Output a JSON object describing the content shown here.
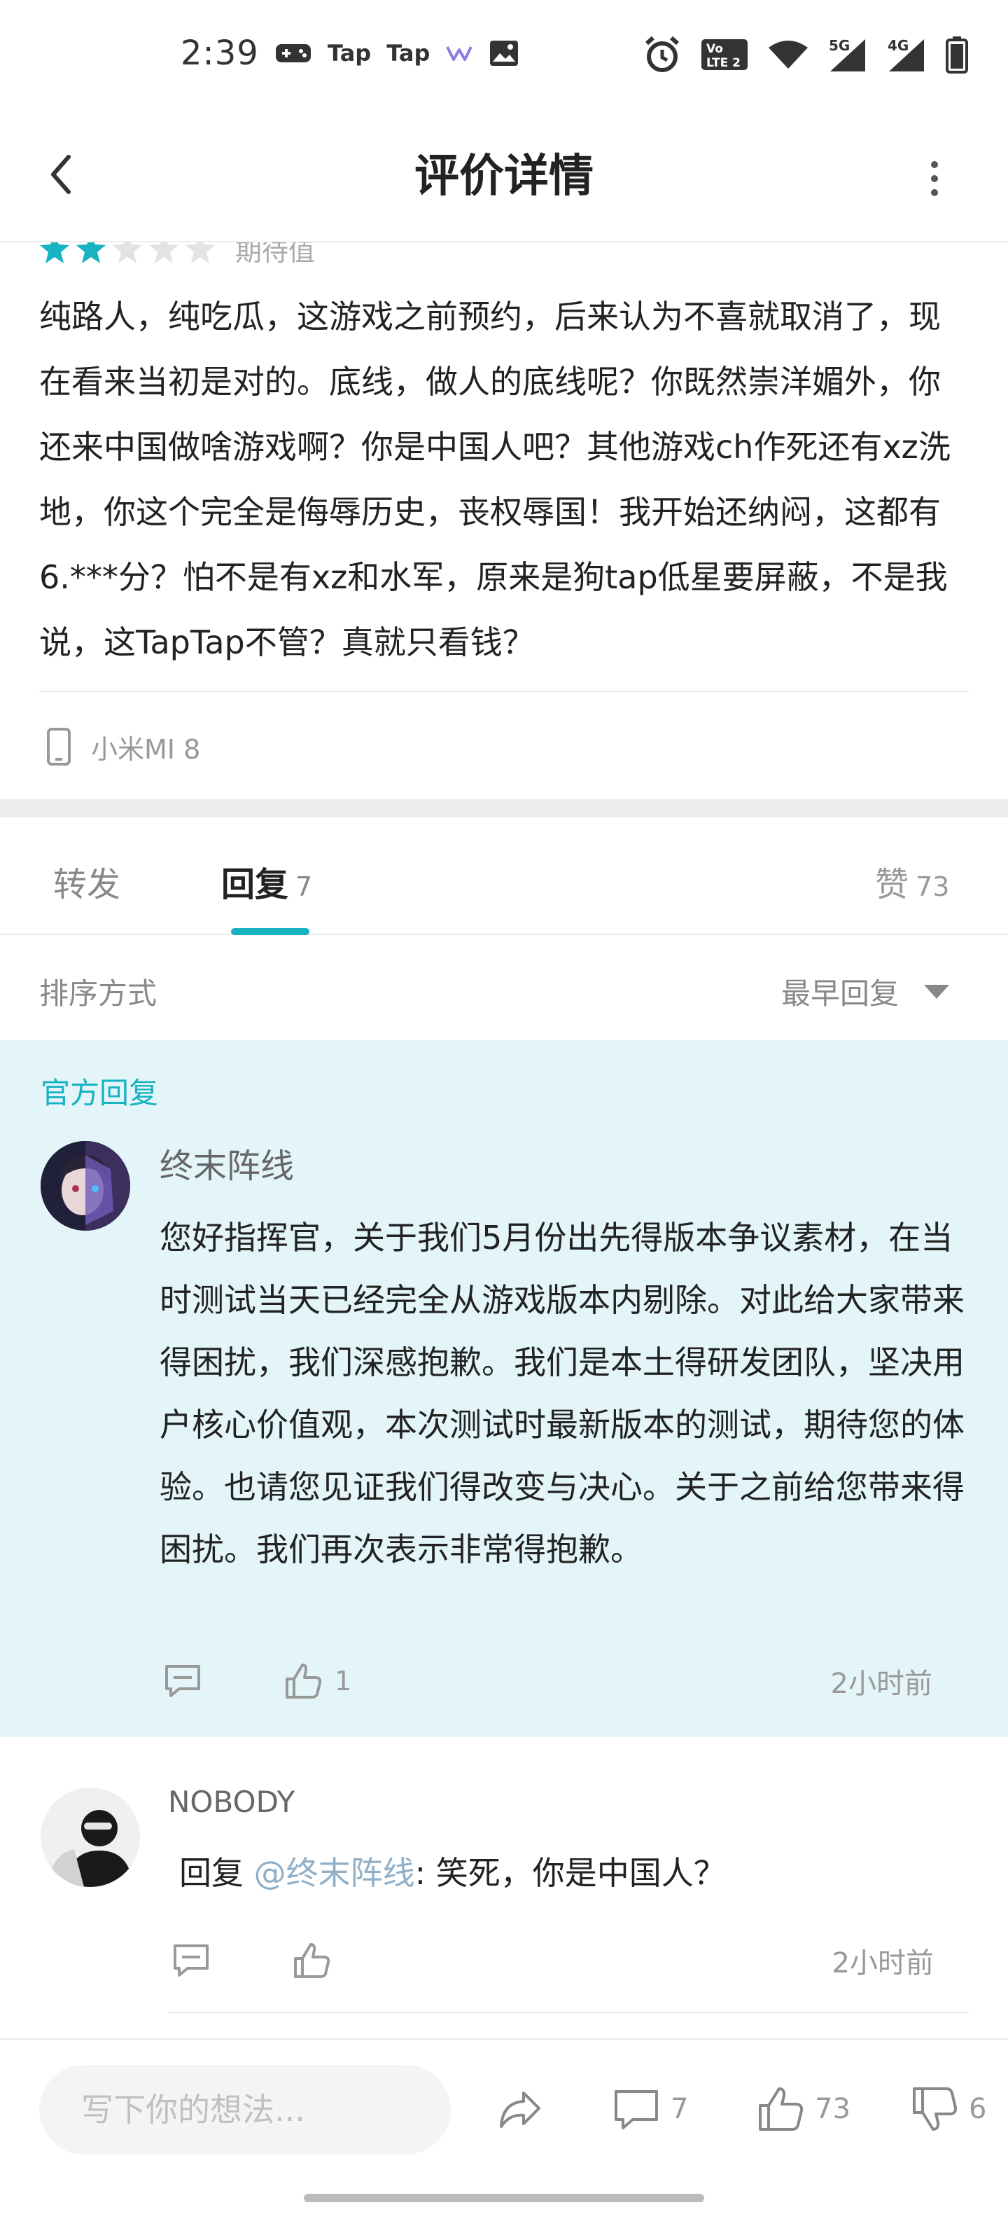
{
  "status_bar": {
    "time": "2:39",
    "icons_left": [
      "gamepad-icon",
      "taptap-icon",
      "taptap-icon",
      "w-app-icon",
      "image-icon"
    ],
    "taptap_label_1": "Tap",
    "taptap_label_2": "Tap",
    "icons_right": [
      "alarm-icon",
      "volte-icon",
      "wifi-icon",
      "signal-5g-icon",
      "signal-4g-icon",
      "battery-icon"
    ],
    "volte_label": "Vo LTE 2",
    "net_5g": "5G",
    "net_4g": "4G"
  },
  "navbar": {
    "title": "评价详情",
    "back_icon": "chevron-left-icon",
    "more_icon": "more-vertical-icon"
  },
  "review": {
    "rating_filled": 2,
    "rating_total": 5,
    "rating_label": "期待值",
    "text": "纯路人，纯吃瓜，这游戏之前预约，后来认为不喜就取消了，现在看来当初是对的。底线，做人的底线呢？你既然崇洋媚外，你还来中国做啥游戏啊？你是中国人吧？其他游戏ch作死还有xz洗地，你这个完全是侮辱历史，丧权辱国！我开始还纳闷，这都有6.***分？怕不是有xz和水军，原来是狗tap低星要屏蔽，不是我说，这TapTap不管？真就只看钱？",
    "device": "小米MI 8"
  },
  "tabs": {
    "forward_label": "转发",
    "reply_label": "回复",
    "reply_count": "7",
    "like_label": "赞",
    "like_count": "73"
  },
  "sort": {
    "label": "排序方式",
    "value": "最早回复"
  },
  "official_reply": {
    "tag": "官方回复",
    "author": "终末阵线",
    "text": "您好指挥官，关于我们5月份出先得版本争议素材，在当时测试当天已经完全从游戏版本内剔除。对此给大家带来得困扰，我们深感抱歉。我们是本土得研发团队，坚决用户核心价值观，本次测试时最新版本的测试，期待您的体验。也请您见证我们得改变与决心。关于之前给您带来得困扰。我们再次表示非常得抱歉。",
    "like_count": "1",
    "time": "2小时前"
  },
  "replies": [
    {
      "author": "NOBODY",
      "prefix": "回复 ",
      "mention": "@终末阵线",
      "body": ": 笑死，你是中国人？",
      "time": "2小时前"
    }
  ],
  "bottom_bar": {
    "input_placeholder": "写下你的想法...",
    "comment_count": "7",
    "like_count": "73",
    "dislike_count": "6"
  },
  "colors": {
    "accent": "#17b3c1",
    "official_bg": "#e4f5f9",
    "star_filled": "#17b3c1",
    "star_empty": "#e3e3e3"
  }
}
